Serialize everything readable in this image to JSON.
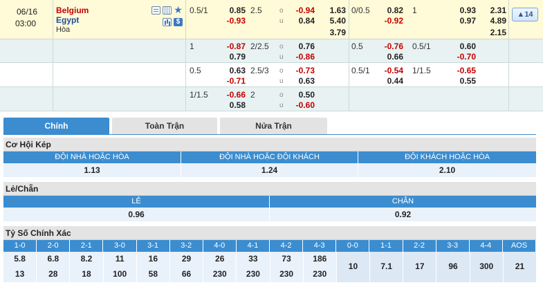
{
  "match": {
    "date": "06/16",
    "time": "03:00",
    "home": "Belgium",
    "away": "Egypt",
    "draw": "Hòa",
    "more_label": "14"
  },
  "icons": [
    "table-icon",
    "grid-icon",
    "star-icon",
    "bars-icon",
    "dollar-icon"
  ],
  "rows": [
    {
      "ah1": {
        "line": "0.5/1",
        "h": "0.85",
        "a": "-0.93"
      },
      "ou1": {
        "line": "2.5",
        "o": "-0.94",
        "u": "0.84"
      },
      "x1": [
        "1.63",
        "5.40",
        "3.79"
      ],
      "ah2": {
        "line": "0/0.5",
        "h": "0.82",
        "a": "-0.92"
      },
      "ou2": {
        "line": "1",
        "o": "0.93",
        "u": "0.97"
      },
      "x2": [
        "2.31",
        "4.89",
        "2.15"
      ]
    },
    {
      "ah1": {
        "line": "1",
        "h": "-0.87",
        "a": "0.79"
      },
      "ou1": {
        "line": "2/2.5",
        "o": "0.76",
        "u": "-0.86"
      },
      "ah2": {
        "line": "0.5",
        "h": "-0.76",
        "a": "0.66"
      },
      "ou2": {
        "line": "0.5/1",
        "o": "0.60",
        "u": "-0.70"
      }
    },
    {
      "ah1": {
        "line": "0.5",
        "h": "0.63",
        "a": "-0.71"
      },
      "ou1": {
        "line": "2.5/3",
        "o": "-0.73",
        "u": "0.63"
      },
      "ah2": {
        "line": "0.5/1",
        "h": "-0.54",
        "a": "0.44"
      },
      "ou2": {
        "line": "1/1.5",
        "o": "-0.65",
        "u": "0.55"
      }
    },
    {
      "ah1": {
        "line": "1/1.5",
        "h": "-0.66",
        "a": "0.58"
      },
      "ou1": {
        "line": "2",
        "o": "0.50",
        "u": "-0.60"
      }
    }
  ],
  "ou_labels": {
    "o": "o",
    "u": "u"
  },
  "tabs": [
    "Chính",
    "Toàn Trận",
    "Nửa Trận"
  ],
  "double_chance": {
    "title": "Cơ Hội Kép",
    "headers": [
      "ĐỘI NHÀ HOẶC HÒA",
      "ĐỘI NHÀ HOẶC ĐỘI KHÁCH",
      "ĐỘI KHÁCH HOẶC HÒA"
    ],
    "values": [
      "1.13",
      "1.24",
      "2.10"
    ]
  },
  "odd_even": {
    "title": "Lẻ/Chẵn",
    "headers": [
      "LẺ",
      "CHẴN"
    ],
    "values": [
      "0.96",
      "0.92"
    ]
  },
  "correct_score": {
    "title": "Tỷ Số Chính Xác",
    "headers": [
      "1-0",
      "2-0",
      "2-1",
      "3-0",
      "3-1",
      "3-2",
      "4-0",
      "4-1",
      "4-2",
      "4-3",
      "0-0",
      "1-1",
      "2-2",
      "3-3",
      "4-4",
      "AOS"
    ],
    "home_row": [
      "5.8",
      "6.8",
      "8.2",
      "11",
      "16",
      "29",
      "26",
      "33",
      "73",
      "186"
    ],
    "away_row": [
      "13",
      "28",
      "18",
      "100",
      "58",
      "66",
      "230",
      "230",
      "230",
      "230"
    ],
    "draw_row": [
      "10",
      "7.1",
      "17",
      "96",
      "300",
      "21"
    ]
  }
}
